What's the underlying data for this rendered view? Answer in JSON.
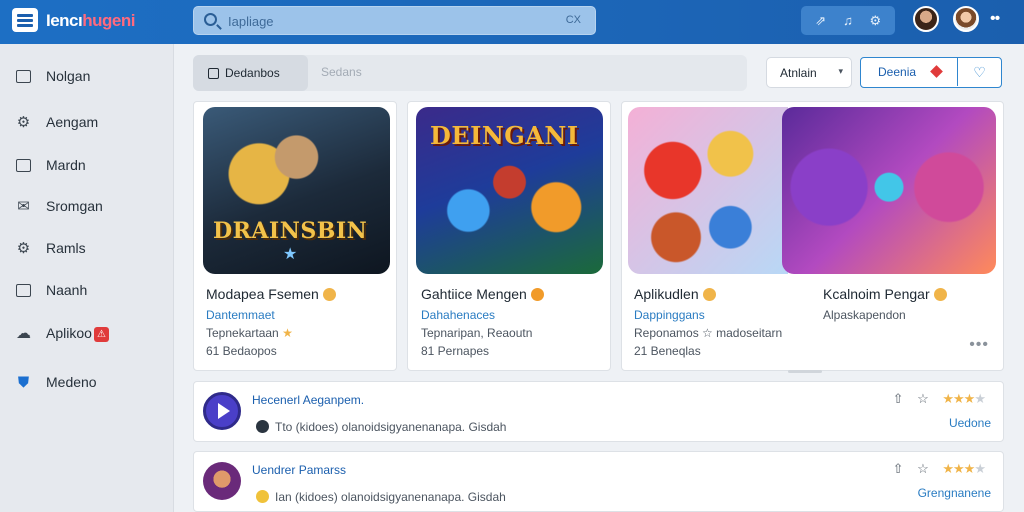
{
  "app": {
    "logo_text_a": "Iencı",
    "logo_text_b": "hugeni"
  },
  "search": {
    "placeholder": "Iapliage",
    "shortcut": "CX"
  },
  "toolbar": {
    "icons": [
      "share-icon",
      "bell-icon",
      "settings-icon"
    ]
  },
  "sidebar": {
    "items": [
      {
        "label": "Nolgan",
        "icon": "grid-icon"
      },
      {
        "label": "Aengam",
        "icon": "gear-icon"
      },
      {
        "label": "Mardn",
        "icon": "box-icon"
      },
      {
        "label": "Sromgan",
        "icon": "mail-icon"
      },
      {
        "label": "Ramls",
        "icon": "gear-icon"
      },
      {
        "label": "Naanh",
        "icon": "chart-icon"
      },
      {
        "label": "Aplikoo",
        "icon": "cloud-icon",
        "badge": "⚠"
      },
      {
        "label": "Medeno",
        "icon": "shield-icon"
      }
    ]
  },
  "tabs": {
    "active": "Dedanbos",
    "inactive": "Sedans"
  },
  "controls": {
    "sort_label": "Atnlain",
    "split_label": "Deenia"
  },
  "cards": [
    {
      "art_title": "DRAINSBIN",
      "title": "Modapea Fsemen",
      "developer": "Dantemmaet",
      "meta": "Tepnekartaan",
      "count": "61 Bedaopos"
    },
    {
      "art_title": "DEINGANI",
      "title": "Gahtiice Mengen",
      "developer": "Dahahenaces",
      "meta": "Tepnaripan, Reaoutn",
      "count": "81 Pernapes"
    },
    {
      "title": "Aplikudlen",
      "developer": "Dappinggans",
      "meta": "Reponamos ☆ madoseitarn",
      "count": "21 Beneqlas"
    },
    {
      "title": "Kcalnoim Pengar",
      "developer": "Alpaskapendon",
      "meta": "",
      "count": ""
    }
  ],
  "rows": [
    {
      "title": "Hecenerl Aeganpem.",
      "subtitle": "Tto (kidoes) olanoidsigyanenanapa. Gisdah",
      "rating": 3,
      "status": "Uedone"
    },
    {
      "title": "Uendrer Pamarss",
      "subtitle": "Ian (kidoes) olanoidsigyanenanapa. Gisdah",
      "rating": 3,
      "status": "Grengnanene"
    }
  ],
  "colors": {
    "topbar": "#1d6fc4",
    "accent": "#2a7cc2",
    "badge": "#e03b3b",
    "star": "#f0b449"
  }
}
